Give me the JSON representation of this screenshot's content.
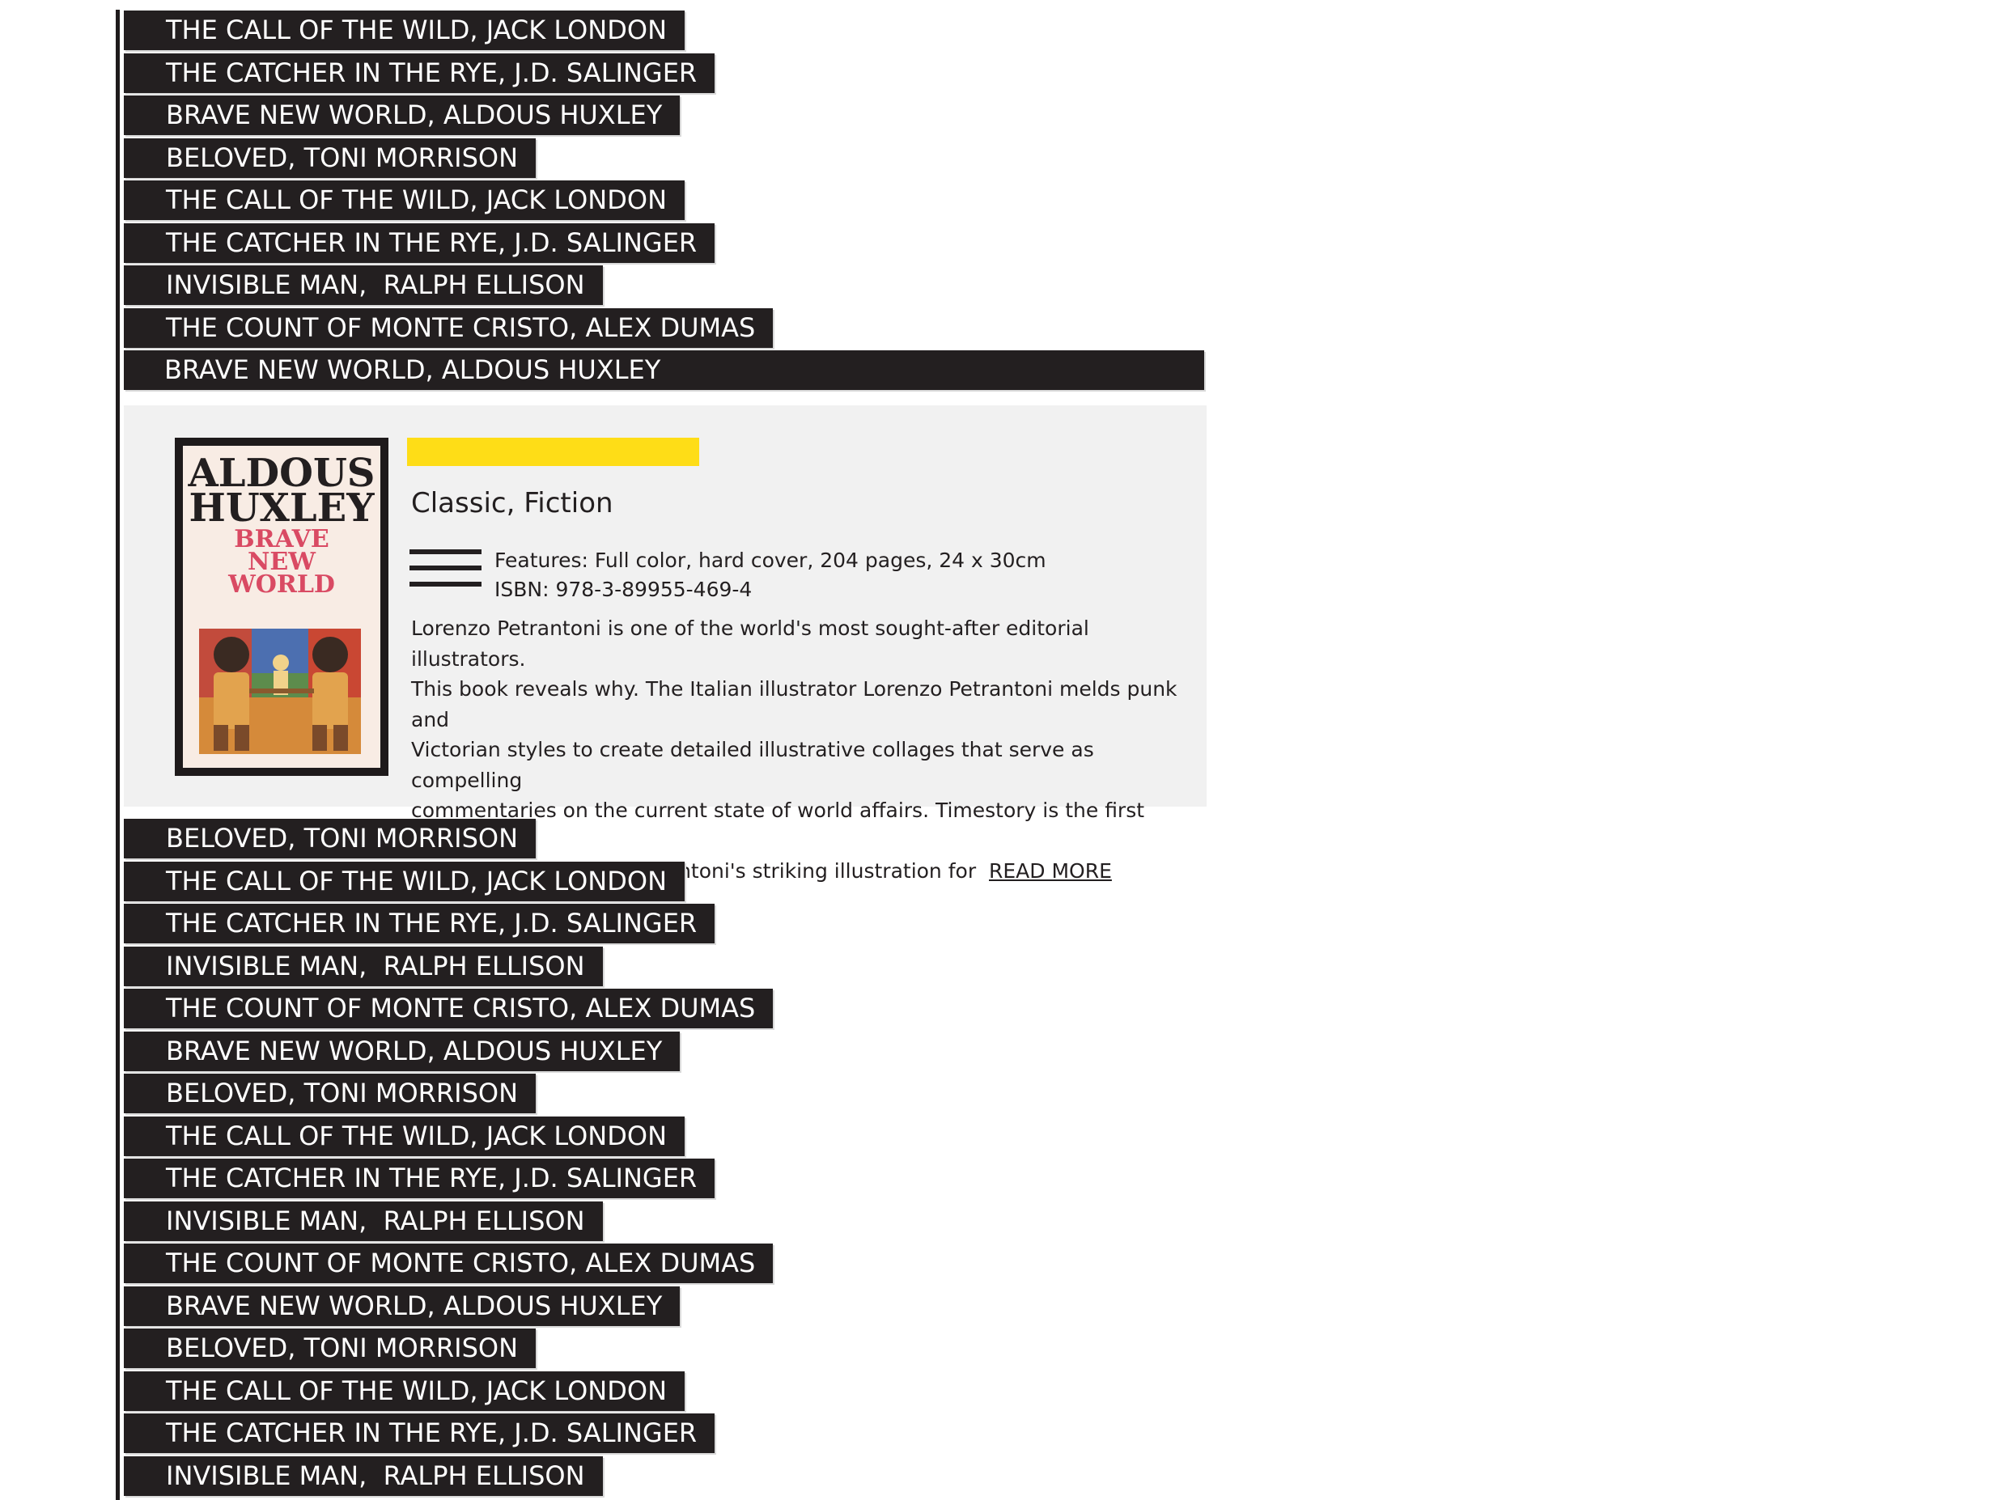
{
  "top_list": [
    {
      "label": "THE CALL OF THE WILD, JACK LONDON"
    },
    {
      "label": "THE CATCHER IN THE RYE, J.D. SALINGER"
    },
    {
      "label": "BRAVE NEW WORLD, ALDOUS HUXLEY"
    },
    {
      "label": "BELOVED, TONI MORRISON"
    },
    {
      "label": "THE CALL OF THE WILD, JACK LONDON"
    },
    {
      "label": "THE CATCHER IN THE RYE, J.D. SALINGER"
    },
    {
      "label": "INVISIBLE MAN,  RALPH ELLISON"
    },
    {
      "label": "THE COUNT OF MONTE CRISTO, ALEX DUMAS"
    },
    {
      "label": "BRAVE NEW WORLD, ALDOUS HUXLEY"
    }
  ],
  "detail": {
    "cover": {
      "author_line1": "ALDOUS",
      "author_line2": "HUXLEY",
      "title_line1": "BRAVE",
      "title_line2": "NEW",
      "title_line3": "WORLD"
    },
    "accent_color": "#fedd17",
    "genre": "Classic, Fiction",
    "features": "Features: Full color, hard cover, 204 pages, 24 x 30cm",
    "isbn": "ISBN: 978-3-89955-469-4",
    "description_lines": [
      "Lorenzo Petrantoni is one of the world's most sought-after editorial illustrators.",
      "This book reveals why. The Italian illustrator Lorenzo Petrantoni melds punk and",
      "Victorian styles to create detailed illustrative collages that serve as compelling",
      "commentaries on the current state of world affairs. Timestory is the first compre-",
      "hensive collection of Petrantoni's striking illustration for  "
    ],
    "read_more": "READ MORE",
    "menu_icon": "hamburger-menu-icon"
  },
  "bottom_list": [
    {
      "label": "BELOVED, TONI MORRISON"
    },
    {
      "label": "THE CALL OF THE WILD, JACK LONDON"
    },
    {
      "label": "THE CATCHER IN THE RYE, J.D. SALINGER"
    },
    {
      "label": "INVISIBLE MAN,  RALPH ELLISON"
    },
    {
      "label": "THE COUNT OF MONTE CRISTO, ALEX DUMAS"
    },
    {
      "label": "BRAVE NEW WORLD, ALDOUS HUXLEY"
    },
    {
      "label": "BELOVED, TONI MORRISON"
    },
    {
      "label": "THE CALL OF THE WILD, JACK LONDON"
    },
    {
      "label": "THE CATCHER IN THE RYE, J.D. SALINGER"
    },
    {
      "label": "INVISIBLE MAN,  RALPH ELLISON"
    },
    {
      "label": "THE COUNT OF MONTE CRISTO, ALEX DUMAS"
    },
    {
      "label": "BRAVE NEW WORLD, ALDOUS HUXLEY"
    },
    {
      "label": "BELOVED, TONI MORRISON"
    },
    {
      "label": "THE CALL OF THE WILD, JACK LONDON"
    },
    {
      "label": "THE CATCHER IN THE RYE, J.D. SALINGER"
    },
    {
      "label": "INVISIBLE MAN,  RALPH ELLISON"
    }
  ]
}
